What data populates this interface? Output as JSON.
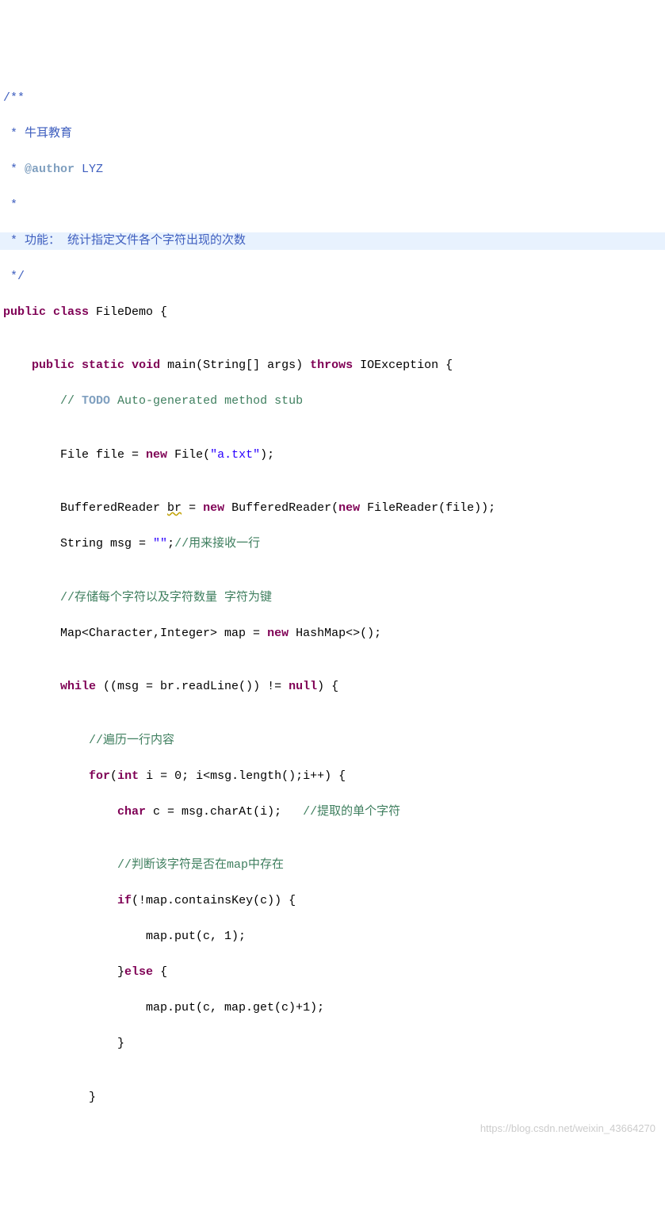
{
  "doc": {
    "start": "/**",
    "l1": " * 牛耳教育",
    "l2a": " * ",
    "l2tag": "@author",
    "l2b": " LYZ",
    "l3": " *",
    "l4": " * 功能： 统计指定文件各个字符出现的次数",
    "end": " */"
  },
  "code": {
    "class_decl_a": "public",
    "class_decl_b": "class",
    "class_name": " FileDemo {",
    "main_a": "public",
    "main_b": "static",
    "main_c": "void",
    "main_name": " main(String[] args) ",
    "main_throws": "throws",
    "main_exc": " IOException {",
    "todo_slash": "// ",
    "todo_kw": "TODO",
    "todo_rest": " Auto-generated method stub",
    "file_a": "File file = ",
    "kw_new": "new",
    "file_b": " File(",
    "str_a": "\"a.txt\"",
    "file_c": ");",
    "br_a": "BufferedReader ",
    "br_var": "br",
    "br_b": " = ",
    "br_c": " BufferedReader(",
    "br_d": " FileReader(file));",
    "msg_a": "String msg = ",
    "str_empty": "\"\"",
    "msg_b": ";",
    "cm_line": "//用来接收一行",
    "cm_store": "//存储每个字符以及字符数量 字符为键",
    "map_a": "Map<Character,Integer> map = ",
    "map_b": " HashMap<>();",
    "while_kw": "while",
    "while_cond_a": " ((msg = br.readLine()) != ",
    "null_kw": "null",
    "while_cond_b": ") {",
    "cm_iter": "//遍历一行内容",
    "for_kw": "for",
    "for_a": "(",
    "int_kw": "int",
    "for_b": " i = 0; i<msg.length();i++) {",
    "char_kw": "char",
    "char_a": " c = msg.charAt(i);   ",
    "cm_extract": "//提取的单个字符",
    "cm_judge": "//判断该字符是否在map中存在",
    "if_kw": "if",
    "if_a": "(!map.containsKey(c)) {",
    "put1": "map.put(c, 1);",
    "else_a": "}",
    "else_kw": "else",
    "else_b": " {",
    "put2": "map.put(c, map.get(c)+1);",
    "close1": "}",
    "close2": "}"
  },
  "watermark": "https://blog.csdn.net/weixin_43664270"
}
